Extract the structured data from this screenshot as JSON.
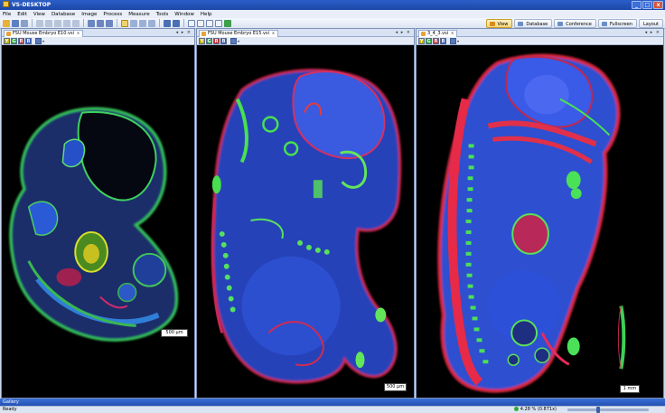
{
  "app": {
    "title": "VS-DESKTOP",
    "window_controls": [
      "_",
      "□",
      "x"
    ]
  },
  "menu": [
    "File",
    "Edit",
    "View",
    "Database",
    "Image",
    "Process",
    "Measure",
    "Tools",
    "Window",
    "Help"
  ],
  "modes": {
    "view": "View",
    "database": "Database",
    "conference": "Conference",
    "fullscreen": "Fullscreen",
    "layout": "Layout"
  },
  "channels": [
    "Y",
    "G",
    "R",
    "B"
  ],
  "panes": [
    {
      "tab": "FSU Mouse Embryo E10.vsi",
      "close": "x",
      "nav": "◂ ▸ ×",
      "scalebar": "500 µm"
    },
    {
      "tab": "FSU Mouse Embryo E15.vsi",
      "close": "x",
      "nav": "◂ ▸ ×",
      "scalebar": "500 µm"
    },
    {
      "tab": "3_4_3.vsi",
      "close": "x",
      "nav": "◂ ▸ ×",
      "scalebar": "1 mm"
    }
  ],
  "gallery": {
    "label": "Gallery"
  },
  "status": {
    "text": "Ready",
    "zoom": "4.28 % (0.871x)",
    "zoom_slider_fraction": 0.35
  },
  "colors": {
    "title_bar": "#2451b4",
    "stain_blue": "#2a4fd6",
    "stain_green": "#43e04a",
    "stain_red": "#d8264a",
    "background": "#000000"
  }
}
